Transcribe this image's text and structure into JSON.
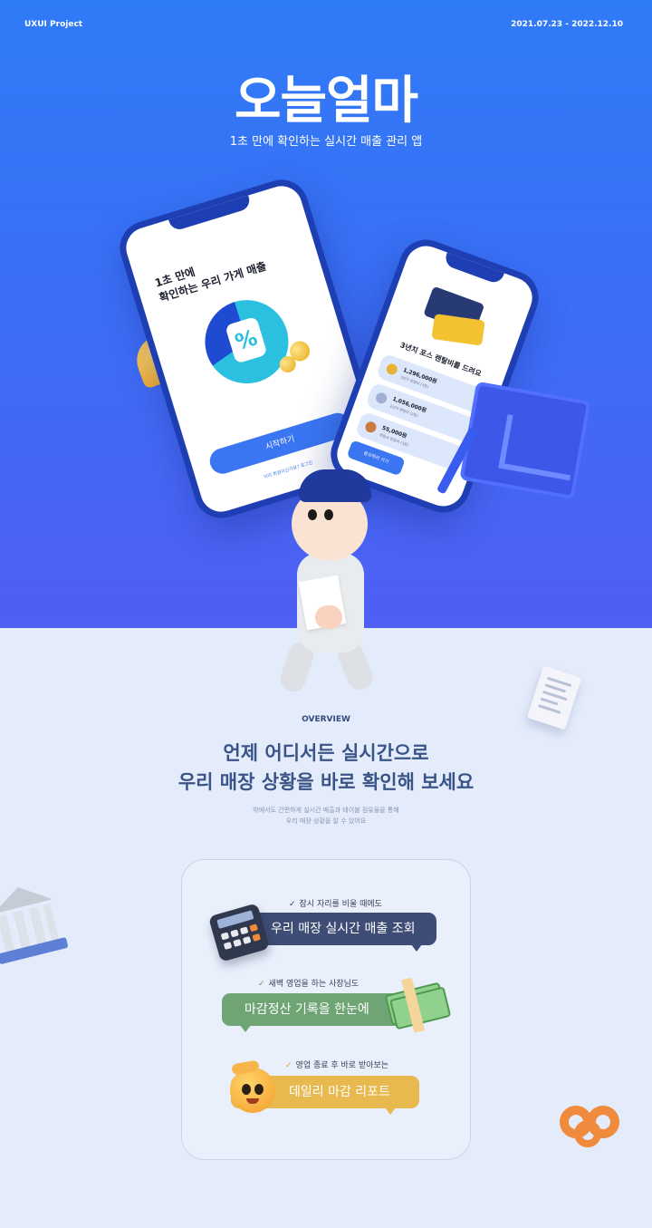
{
  "header": {
    "project": "UXUI Project",
    "period": "2021.07.23 - 2022.12.10"
  },
  "hero": {
    "brand": "오늘얼마",
    "tagline": "1초 만에 확인하는 실시간 매출 관리 앱"
  },
  "phone_a": {
    "title_line1": "1초 만에",
    "title_line2": "확인하는 우리 가게 매출",
    "percent_symbol": "%",
    "start_button": "시작하기",
    "login_link": "이미 회원이신가요? 로그인"
  },
  "phone_b": {
    "title": "3년치 포스 렌탈비를 드려요",
    "items": [
      {
        "amount": "1,296,000원",
        "sub": "3년치 렌탈비 (3등)",
        "medal_color": "#e8b335"
      },
      {
        "amount": "1,056,000원",
        "sub": "2년치 렌탈비 (2등)",
        "medal_color": "#9fb0d4"
      },
      {
        "amount": "55,000원",
        "sub": "렌탈비 렌탈비 (3등)",
        "medal_color": "#c97b3f"
      }
    ],
    "button": "응모하러 가기"
  },
  "overview": {
    "label": "OVERVIEW",
    "title_line1": "언제 어디서든 실시간으로",
    "title_line2": "우리 매장 상황을 바로 확인해 보세요",
    "desc_line1": "밖에서도 간편하게 실시간 매출과 테이블 점유율을 통해",
    "desc_line2": "우리 매장 상황을 알 수 있어요"
  },
  "features": [
    {
      "check": "✓",
      "caption": "잠시 자리를 비울 때에도",
      "bubble": "우리 매장 실시간 매출 조회",
      "color": "#3d4d75"
    },
    {
      "check": "✓",
      "caption": "새벽 영업을 하는 사장님도",
      "bubble": "마감정산 기록을 한눈에",
      "color": "#6fa574"
    },
    {
      "check": "✓",
      "caption": "영업 종료 후 바로 받아보는",
      "bubble": "데일리 마감 리포트",
      "color": "#e8b94f"
    }
  ],
  "icons": [
    "bell-icon",
    "calendar-chart-icon",
    "pen-icon",
    "receipt-icon",
    "bank-icon",
    "pretzel-icon",
    "calculator-icon",
    "money-icon",
    "smile-emoji-icon"
  ],
  "colors": {
    "hero_top": "#2f7bf7",
    "hero_bottom": "#4f5ff3",
    "background": "#e4ecfb",
    "accent": "#3a76f2"
  }
}
